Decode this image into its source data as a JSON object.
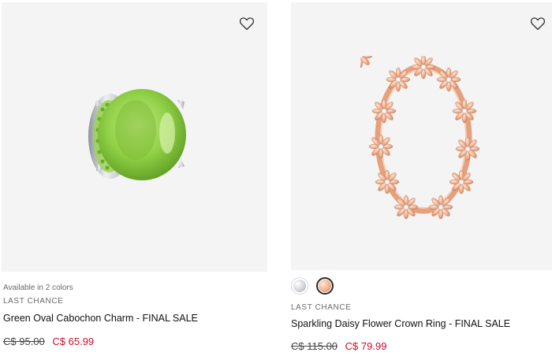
{
  "products": [
    {
      "availability": "Available in 2 colors",
      "tag": "LAST CHANCE",
      "name": "Green Oval Cabochon Charm - FINAL SALE",
      "old_price": "C$ 95.00",
      "new_price": "C$ 65.99",
      "image_icon": "green-oval-charm",
      "colors": {
        "stone": "#8fcf45",
        "metal": "#c9cdd3"
      }
    },
    {
      "tag": "LAST CHANCE",
      "name": "Sparkling Daisy Flower Crown Ring - FINAL SALE",
      "old_price": "C$ 115.00",
      "new_price": "C$ 79.99",
      "image_icon": "daisy-crown-ring",
      "swatches": [
        "silver",
        "rose-gold"
      ],
      "selected_swatch": "rose-gold",
      "colors": {
        "metal": "#efb08e"
      }
    }
  ],
  "colors": {
    "sale_price": "#c8102e",
    "image_bg": "#f4f4f4"
  }
}
